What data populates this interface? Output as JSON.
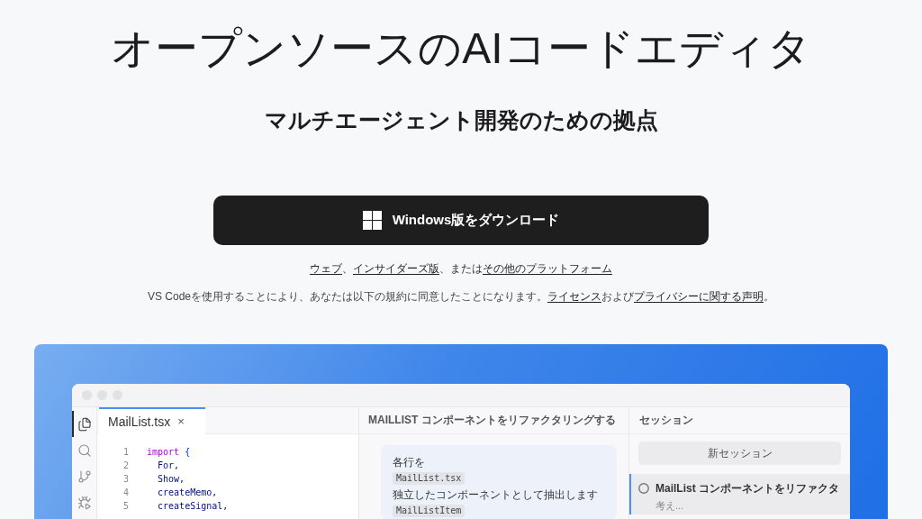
{
  "hero": {
    "title": "オープンソースのAIコードエディタ",
    "subtitle": "マルチエージェント開発のための拠点"
  },
  "download_button": {
    "label": "Windows版をダウンロード"
  },
  "alternatives": [
    {
      "kind": "link",
      "text": "ウェブ"
    },
    {
      "kind": "text",
      "text": "、"
    },
    {
      "kind": "link",
      "text": "インサイダーズ版"
    },
    {
      "kind": "text",
      "text": "、または"
    },
    {
      "kind": "link",
      "text": "その他のプラットフォーム"
    }
  ],
  "legal": [
    {
      "kind": "text",
      "text": "VS Codeを使用することにより、あなたは以下の規約に同意したことになります。"
    },
    {
      "kind": "link",
      "text": "ライセンス"
    },
    {
      "kind": "text",
      "text": "および"
    },
    {
      "kind": "link",
      "text": "プライバシーに関する声明"
    },
    {
      "kind": "text",
      "text": "。"
    }
  ],
  "editor": {
    "activity_bar": [
      {
        "kind": "files",
        "selected": true
      },
      {
        "kind": "search",
        "selected": false
      },
      {
        "kind": "source_control",
        "selected": false
      },
      {
        "kind": "run",
        "selected": false
      }
    ],
    "tabs": [
      {
        "label": "MailList.tsx",
        "close": "×",
        "selected": true
      }
    ],
    "code": [
      {
        "number": "1",
        "tokens": [
          {
            "kind": "keyword",
            "text": "import"
          },
          {
            "kind": "punct",
            "text": " {"
          }
        ]
      },
      {
        "number": "2",
        "tokens": [
          {
            "kind": "ident",
            "text": "  For,"
          }
        ]
      },
      {
        "number": "3",
        "tokens": [
          {
            "kind": "ident",
            "text": "  Show,"
          }
        ]
      },
      {
        "number": "4",
        "tokens": [
          {
            "kind": "ident",
            "text": "  createMemo,"
          }
        ]
      },
      {
        "number": "5",
        "tokens": [
          {
            "kind": "ident",
            "text": "  createSignal,"
          }
        ]
      }
    ],
    "chat": {
      "title": "MAILLIST コンポーネントをリファクタリングする",
      "message": [
        {
          "kind": "text",
          "text": "各行を"
        },
        {
          "kind": "code",
          "text": "MailList.tsx"
        },
        {
          "kind": "text",
          "text": "独立したコンポーネントとして抽出します"
        },
        {
          "kind": "code",
          "text": "MailListItem"
        }
      ]
    },
    "sessions": {
      "title": "セッション",
      "new_button": "新セッション",
      "items": [
        {
          "title": "MailList コンポーネントをリファクタ",
          "status": "考え...",
          "selected": true
        }
      ]
    }
  }
}
